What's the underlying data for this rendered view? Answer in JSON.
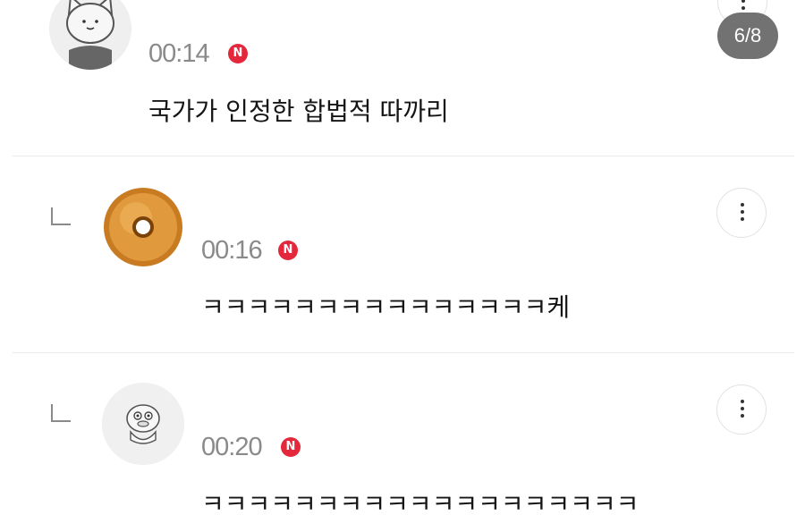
{
  "pager": {
    "label": "6/8"
  },
  "comments": [
    {
      "avatar_icon": "cat-character-icon",
      "time": "00:14",
      "badge": "N",
      "text": "국가가 인정한 합법적 따까리",
      "is_reply": false
    },
    {
      "avatar_icon": "donut-icon",
      "time": "00:16",
      "badge": "N",
      "text": "ㅋㅋㅋㅋㅋㅋㅋㅋㅋㅋㅋㅋㅋㅋㅋ케",
      "is_reply": true
    },
    {
      "avatar_icon": "duck-character-icon",
      "time": "00:20",
      "badge": "N",
      "text": "ㅋㅋㅋㅋㅋㅋㅋㅋㅋㅋㅋㅋㅋㅋㅋㅋㅋㅋㅋ",
      "is_reply": true
    }
  ],
  "colors": {
    "badge": "#e3283c",
    "time": "#8a8a8a",
    "pager_bg": "#5f5f5f"
  }
}
